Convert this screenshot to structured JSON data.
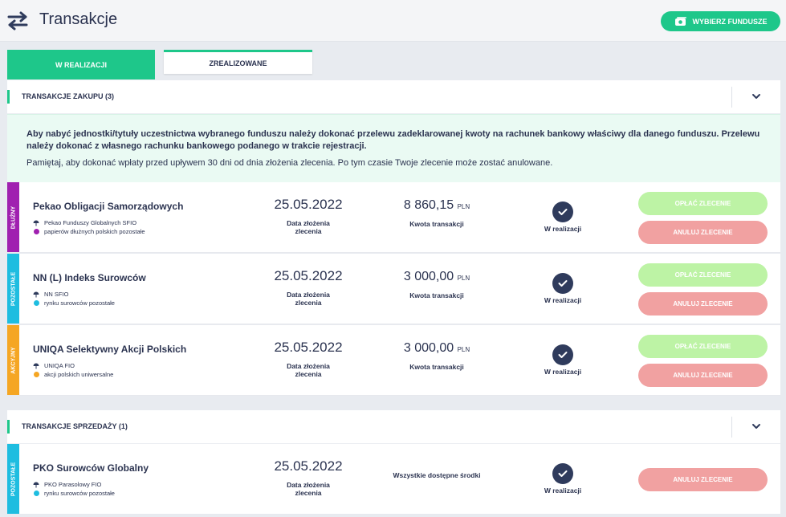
{
  "header": {
    "title": "Transakcje",
    "choose_funds_label": "WYBIERZ FUNDUSZE"
  },
  "tabs": [
    {
      "label": "W REALIZACJI",
      "active": true
    },
    {
      "label": "ZREALIZOWANE",
      "active": false
    }
  ],
  "purchases": {
    "title": "TRANSAKCJE ZAKUPU (3)",
    "info_bold": "Aby nabyć jednostki/tytuły uczestnictwa wybranego funduszu należy dokonać przelewu zadeklarowanej kwoty na rachunek bankowy właściwy dla danego funduszu. Przelewu należy dokonać z własnego rachunku bankowego podanego w trakcie rejestracji.",
    "info_normal": "Pamiętaj, aby dokonać wpłaty przed upływem 30 dni od dnia złożenia zlecenia. Po tym czasie Twoje zlecenie może zostać anulowane.",
    "rows": [
      {
        "category": "DŁUŻNY",
        "category_color": "#a020b0",
        "fund": "Pekao Obligacji Samorządowych",
        "company": "Pekao Funduszy Globalnych SFIO",
        "type": "papierów dłużnych polskich pozostałe",
        "date": "25.05.2022",
        "date_label": "Data złożenia zlecenia",
        "amount": "8 860,15",
        "currency": "PLN",
        "amount_label": "Kwota transakcji",
        "status": "W realizacji",
        "pay_label": "OPŁAĆ ZLECENIE",
        "cancel_label": "ANULUJ ZLECENIE"
      },
      {
        "category": "POZOSTAŁE",
        "category_color": "#1ebde0",
        "fund": "NN (L) Indeks Surowców",
        "company": "NN SFIO",
        "type": "rynku surowców pozostałe",
        "date": "25.05.2022",
        "date_label": "Data złożenia zlecenia",
        "amount": "3 000,00",
        "currency": "PLN",
        "amount_label": "Kwota transakcji",
        "status": "W realizacji",
        "pay_label": "OPŁAĆ ZLECENIE",
        "cancel_label": "ANULUJ ZLECENIE"
      },
      {
        "category": "AKCYJNY",
        "category_color": "#f5a623",
        "fund": "UNIQA Selektywny Akcji Polskich",
        "company": "UNIQA FIO",
        "type": "akcji polskich uniwersalne",
        "date": "25.05.2022",
        "date_label": "Data złożenia zlecenia",
        "amount": "3 000,00",
        "currency": "PLN",
        "amount_label": "Kwota transakcji",
        "status": "W realizacji",
        "pay_label": "OPŁAĆ ZLECENIE",
        "cancel_label": "ANULUJ ZLECENIE"
      }
    ]
  },
  "sales": {
    "title": "TRANSAKCJE SPRZEDAŻY (1)",
    "rows": [
      {
        "category": "POZOSTAŁE",
        "category_color": "#1ebde0",
        "fund": "PKO Surowców Globalny",
        "company": "PKO Parasolowy FIO",
        "type": "rynku surowców pozostałe",
        "date": "25.05.2022",
        "date_label": "Data złożenia zlecenia",
        "amount_text": "Wszystkie dostępne środki",
        "status": "W realizacji",
        "cancel_label": "ANULUJ ZLECENIE"
      }
    ]
  },
  "colors": {
    "accent": "#1ec78a",
    "pay_button": "#bdf3a5",
    "cancel_button": "#f1a1a1",
    "status_icon": "#2f3b5c"
  },
  "icons": {
    "header": "swap-arrows-icon",
    "choose_funds": "money-icon",
    "collapse": "chevron-down-icon",
    "status": "checkmark-icon",
    "company": "umbrella-icon",
    "type": "color-dot-icon"
  }
}
